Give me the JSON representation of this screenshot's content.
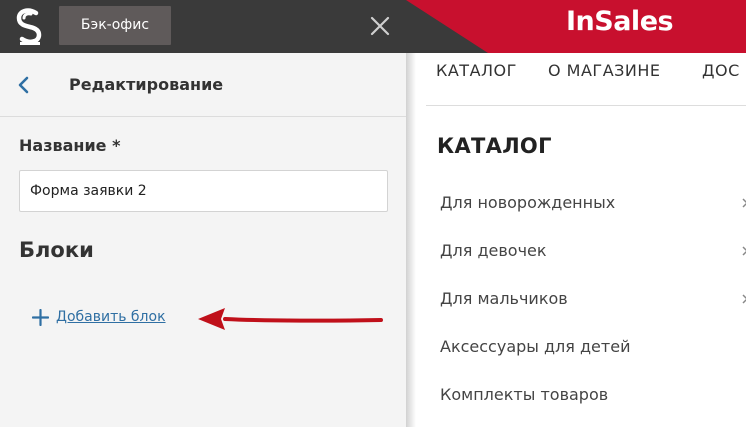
{
  "app": {
    "backoffice_label": "Бэк-офис",
    "brand": "InSales"
  },
  "editor": {
    "title": "Редактирование",
    "name_label": "Название *",
    "name_value": "Форма заявки 2",
    "blocks_title": "Блоки",
    "add_block_label": "Добавить блок"
  },
  "site": {
    "nav": [
      "КАТАЛОГ",
      "О МАГАЗИНЕ",
      "ДОС"
    ],
    "catalog_title": "КАТАЛОГ",
    "categories": [
      "Для новорожденных",
      "Для девочек",
      "Для мальчиков",
      "Аксессуары для детей",
      "Комплекты товаров"
    ]
  },
  "colors": {
    "topbar": "#3a3a3a",
    "brand_banner": "#c8102e",
    "link": "#2f6fa3",
    "arrow": "#c0101a"
  },
  "icons": [
    "logo-icon",
    "close-icon",
    "back-chevron-icon",
    "plus-icon",
    "chevron-right-icon"
  ]
}
